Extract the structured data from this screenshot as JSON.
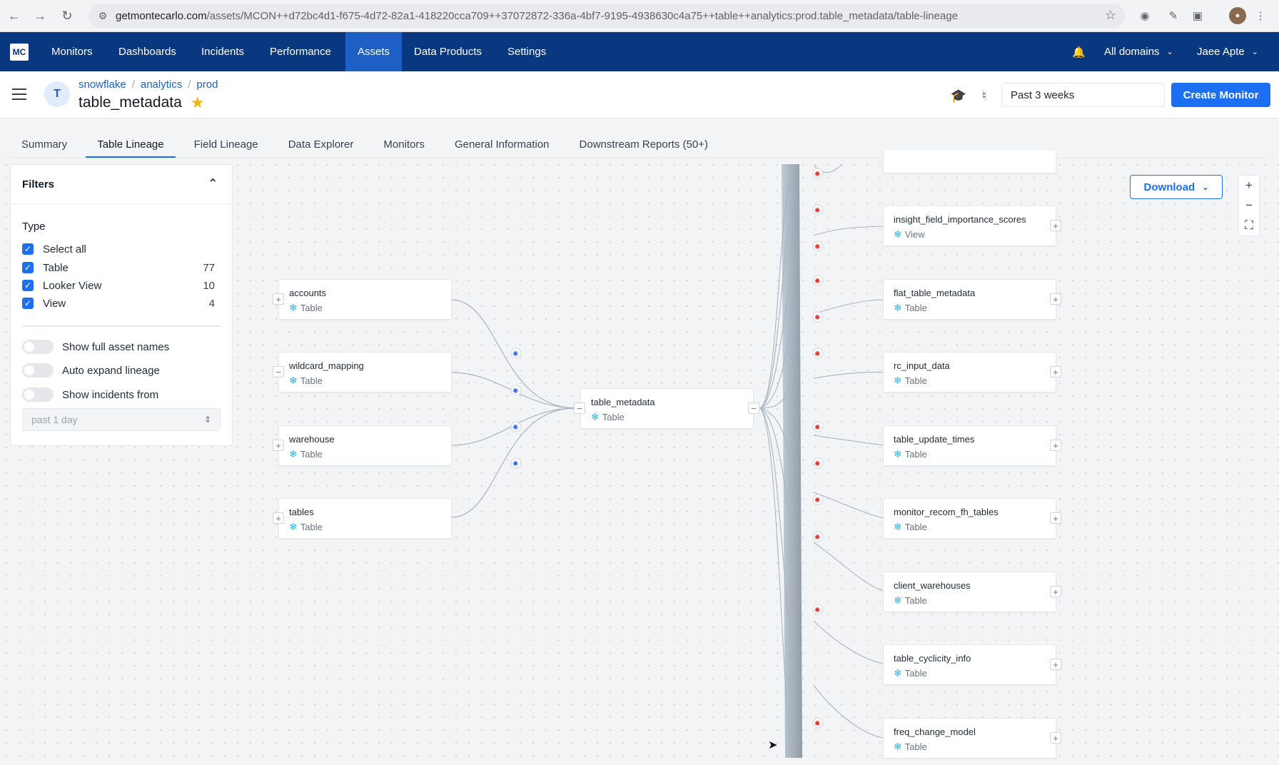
{
  "browser": {
    "url_host": "getmontecarlo.com",
    "url_path": "/assets/MCON++d72bc4d1-f675-4d72-82a1-418220cca709++37072872-336a-4bf7-9195-4938630c4a75++table++analytics:prod.table_metadata/table-lineage"
  },
  "nav": {
    "logo": "MC",
    "items": [
      "Monitors",
      "Dashboards",
      "Incidents",
      "Performance",
      "Assets",
      "Data Products",
      "Settings"
    ],
    "active": "Assets",
    "domains_label": "All domains",
    "user_label": "Jaee Apte"
  },
  "header": {
    "avatar_letter": "T",
    "breadcrumb": [
      "snowflake",
      "analytics",
      "prod"
    ],
    "title": "table_metadata",
    "date_range": "Past 3 weeks",
    "create_monitor_label": "Create Monitor"
  },
  "tabs": [
    "Summary",
    "Table Lineage",
    "Field Lineage",
    "Data Explorer",
    "Monitors",
    "General Information",
    "Downstream Reports (50+)"
  ],
  "active_tab": "Table Lineage",
  "filters": {
    "title": "Filters",
    "type_label": "Type",
    "options": [
      {
        "label": "Select all",
        "count": ""
      },
      {
        "label": "Table",
        "count": "77"
      },
      {
        "label": "Looker View",
        "count": "10"
      },
      {
        "label": "View",
        "count": "4"
      }
    ],
    "toggles": [
      "Show full asset names",
      "Auto expand lineage",
      "Show incidents from"
    ],
    "incidents_range": "past 1 day"
  },
  "lineage": {
    "download_label": "Download",
    "upstream": [
      {
        "name": "accounts",
        "type": "Table"
      },
      {
        "name": "wildcard_mapping",
        "type": "Table"
      },
      {
        "name": "warehouse",
        "type": "Table"
      },
      {
        "name": "tables",
        "type": "Table"
      }
    ],
    "center": {
      "name": "table_metadata",
      "type": "Table"
    },
    "downstream": [
      {
        "name": "insight_field_importance_scores",
        "type": "View"
      },
      {
        "name": "flat_table_metadata",
        "type": "Table"
      },
      {
        "name": "rc_input_data",
        "type": "Table"
      },
      {
        "name": "table_update_times",
        "type": "Table"
      },
      {
        "name": "monitor_recom_fh_tables",
        "type": "Table"
      },
      {
        "name": "client_warehouses",
        "type": "Table"
      },
      {
        "name": "table_cyclicity_info",
        "type": "Table"
      },
      {
        "name": "freq_change_model",
        "type": "Table"
      }
    ]
  }
}
